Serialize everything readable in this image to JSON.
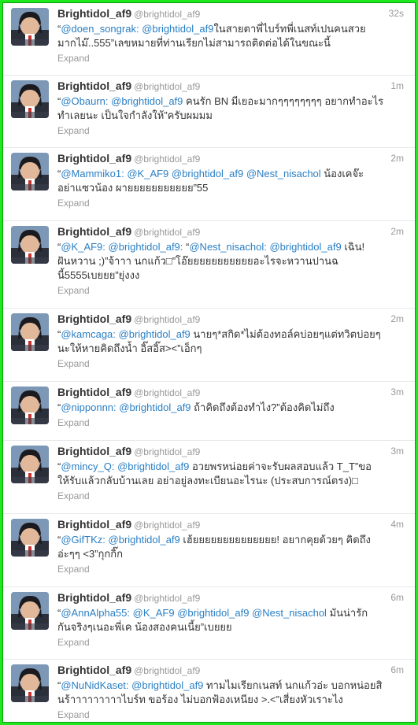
{
  "tweets": [
    {
      "fullname": "Brightidol_af9",
      "username": "@brightidol_af9",
      "time": "32s",
      "lines": [
        [
          {
            "t": "“"
          },
          {
            "t": "@doen_songrak:",
            "m": true
          },
          {
            "t": " "
          },
          {
            "t": "@brightidol_af9",
            "m": true
          },
          {
            "t": "ในสายตาพี่ไบร์ทพี่เนสท์เปนคนสวย"
          }
        ],
        [
          {
            "t": "มากไม๊..555”เลขหมายที่ท่านเรียกไม่สามารถติดต่อได้ในขณะนี้"
          }
        ]
      ],
      "expand": "Expand"
    },
    {
      "fullname": "Brightidol_af9",
      "username": "@brightidol_af9",
      "time": "1m",
      "lines": [
        [
          {
            "t": "“"
          },
          {
            "t": "@Obaurn:",
            "m": true
          },
          {
            "t": " "
          },
          {
            "t": "@brightidol_af9",
            "m": true
          },
          {
            "t": " คนรัก BN มีเยอะมากๆๆๆๆๆๆๆๆ อยากทำอะไร"
          }
        ],
        [
          {
            "t": "ทำเลยนะ เป็นใจกำลังให้”ครับผมมม"
          }
        ]
      ],
      "expand": "Expand"
    },
    {
      "fullname": "Brightidol_af9",
      "username": "@brightidol_af9",
      "time": "2m",
      "lines": [
        [
          {
            "t": "“"
          },
          {
            "t": "@Mammiko1:",
            "m": true
          },
          {
            "t": " "
          },
          {
            "t": "@K_AF9",
            "m": true
          },
          {
            "t": " "
          },
          {
            "t": "@brightidol_af9",
            "m": true
          },
          {
            "t": " "
          },
          {
            "t": "@Nest_nisachol",
            "m": true
          },
          {
            "t": " น้องเคจ๊ะ"
          }
        ],
        [
          {
            "t": "อย่าแซวน้อง ผายยยยยยยยยยย”55"
          }
        ]
      ],
      "expand": "Expand"
    },
    {
      "fullname": "Brightidol_af9",
      "username": "@brightidol_af9",
      "time": "2m",
      "lines": [
        [
          {
            "t": "“"
          },
          {
            "t": "@K_AF9:",
            "m": true
          },
          {
            "t": " "
          },
          {
            "t": "@brightidol_af9:",
            "m": true
          },
          {
            "t": " “"
          },
          {
            "t": "@Nest_nisachol:",
            "m": true
          },
          {
            "t": " "
          },
          {
            "t": "@brightidol_af9",
            "m": true
          },
          {
            "t": " เฉิน!"
          }
        ],
        [
          {
            "t": "ฝันหวาน ;)”จ้าาา นกแก้ว□”โอ๊ยยยยยยยยยยยอะไรจะหวานปานฉ"
          }
        ],
        [
          {
            "t": "นี้5555เบยยย”ยุ่งงง"
          }
        ]
      ],
      "expand": "Expand"
    },
    {
      "fullname": "Brightidol_af9",
      "username": "@brightidol_af9",
      "time": "2m",
      "lines": [
        [
          {
            "t": "“"
          },
          {
            "t": "@kamcaga:",
            "m": true
          },
          {
            "t": " "
          },
          {
            "t": "@brightidol_af9",
            "m": true
          },
          {
            "t": " นายๆ*สกิด*ไม่ต้องทอล์คบ่อยๆแต่ทวิตบ่อยๆ"
          }
        ],
        [
          {
            "t": "นะให้หายคิดถึงน้ำ อิ๊สอิ๊ส><”เอ็กๆ"
          }
        ]
      ],
      "expand": "Expand"
    },
    {
      "fullname": "Brightidol_af9",
      "username": "@brightidol_af9",
      "time": "3m",
      "lines": [
        [
          {
            "t": "“"
          },
          {
            "t": "@nipponnn:",
            "m": true
          },
          {
            "t": " "
          },
          {
            "t": "@brightidol_af9",
            "m": true
          },
          {
            "t": " ถ้าคิดถึงต้องทำไง?”ต้องคิดไม่ถึง"
          }
        ]
      ],
      "expand": "Expand"
    },
    {
      "fullname": "Brightidol_af9",
      "username": "@brightidol_af9",
      "time": "3m",
      "lines": [
        [
          {
            "t": "“"
          },
          {
            "t": "@mincy_Q:",
            "m": true
          },
          {
            "t": " "
          },
          {
            "t": "@brightidol_af9",
            "m": true
          },
          {
            "t": " อวยพรหน่อยค่าจะรับผลสอบแล้ว T_T”ขอ"
          }
        ],
        [
          {
            "t": "ให้รับแล้วกลับบ้านเลย อย่าอยู่ลงทะเบียนอะไรนะ (ประสบการณ์ตรง)□"
          }
        ]
      ],
      "expand": "Expand"
    },
    {
      "fullname": "Brightidol_af9",
      "username": "@brightidol_af9",
      "time": "4m",
      "lines": [
        [
          {
            "t": "“"
          },
          {
            "t": "@GifTKz:",
            "m": true
          },
          {
            "t": " "
          },
          {
            "t": "@brightidol_af9",
            "m": true
          },
          {
            "t": " เฮ้ยยยยยยยยยยยยยย! อยากคุยด้วยๆ คิดถึง"
          }
        ],
        [
          {
            "t": "อ่ะๆๆ <3”กุกกิ๊ก"
          }
        ]
      ],
      "expand": "Expand"
    },
    {
      "fullname": "Brightidol_af9",
      "username": "@brightidol_af9",
      "time": "6m",
      "lines": [
        [
          {
            "t": "“"
          },
          {
            "t": "@AnnAlpha55:",
            "m": true
          },
          {
            "t": " "
          },
          {
            "t": "@K_AF9",
            "m": true
          },
          {
            "t": " "
          },
          {
            "t": "@brightidol_af9",
            "m": true
          },
          {
            "t": " "
          },
          {
            "t": "@Nest_nisachol",
            "m": true
          },
          {
            "t": " มันน่ารัก"
          }
        ],
        [
          {
            "t": "กันจริงๆเนอะพี่เค น้องสองคนเนี้ย”เบยยย"
          }
        ]
      ],
      "expand": "Expand"
    },
    {
      "fullname": "Brightidol_af9",
      "username": "@brightidol_af9",
      "time": "6m",
      "lines": [
        [
          {
            "t": "“"
          },
          {
            "t": "@NuNidKaset:",
            "m": true
          },
          {
            "t": " "
          },
          {
            "t": "@brightidol_af9",
            "m": true
          },
          {
            "t": " ทามไมเรียกเนสท์ นกแก้วอ่ะ บอกหน่อยสิ"
          }
        ],
        [
          {
            "t": "นร้าาาาาาาาาไบร์ท ขอร้อง ไม่บอกฟ้องเหนียง >.<”เสี่ยงหัวเราะไง"
          }
        ]
      ],
      "expand": "Expand"
    }
  ]
}
